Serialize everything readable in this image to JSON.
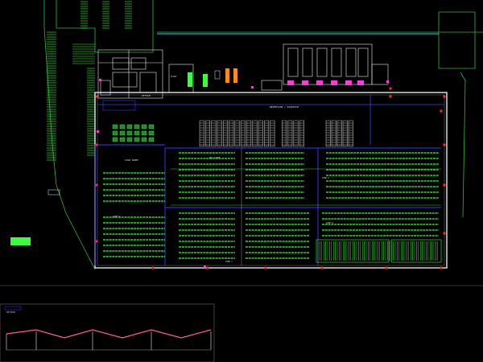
{
  "drawing": {
    "background": "#000000",
    "colors": {
      "green": "#39ff3a",
      "dark_green": "#1c8c2a",
      "white": "#e8e8e8",
      "gray": "#9a9a9a",
      "cyan": "#22d3ee",
      "magenta": "#ff3ad8",
      "red": "#ff2a2a",
      "blue": "#3a3aff",
      "orange": "#ff8a1a",
      "pink": "#ff5a9a"
    },
    "labels": {
      "loading_bay": "RECEPTION / DISPATCH",
      "cold_room": "COLD ROOM",
      "zone_top": "DRY STORE",
      "zone_mid_left": "ZONE A",
      "zone_mid_right": "ZONE B",
      "zone_bottom_left": "ZONE C",
      "zone_bottom_right": "ZONE D",
      "office": "OFFICE",
      "plant": "PLANT",
      "section_title": "SECTION"
    }
  }
}
